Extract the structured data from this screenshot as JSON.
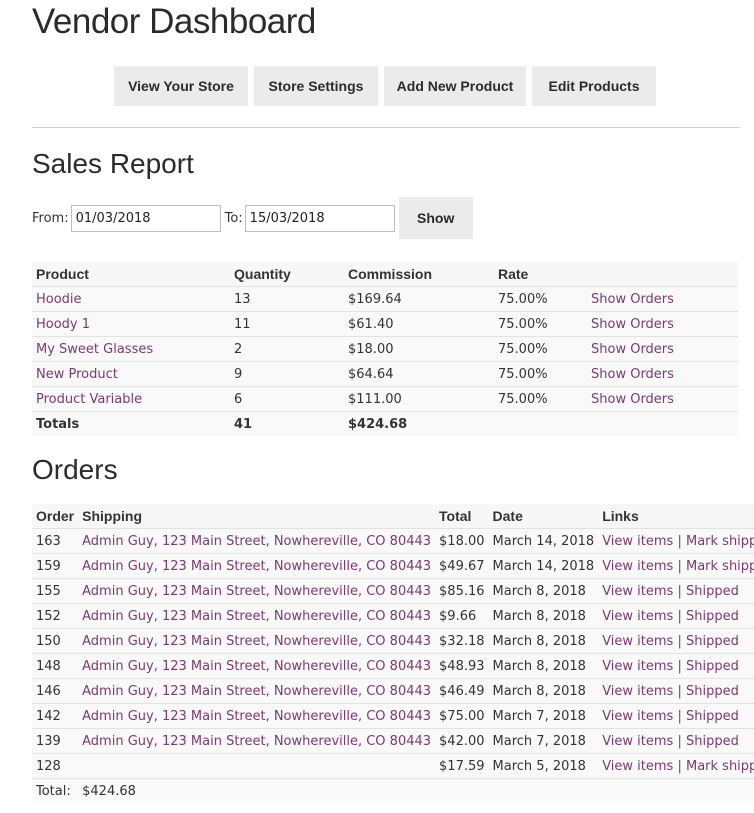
{
  "page": {
    "title": "Vendor Dashboard"
  },
  "nav": [
    {
      "label": "View Your Store"
    },
    {
      "label": "Store Settings"
    },
    {
      "label": "Add New Product"
    },
    {
      "label": "Edit Products"
    }
  ],
  "sales": {
    "title": "Sales Report",
    "from_label": "From:",
    "from_value": "01/03/2018",
    "to_label": "To:",
    "to_value": "15/03/2018",
    "show_label": "Show",
    "headers": {
      "product": "Product",
      "quantity": "Quantity",
      "commission": "Commission",
      "rate": "Rate"
    },
    "rows": [
      {
        "product": "Hoodie",
        "quantity": "13",
        "commission": "$169.64",
        "rate": "75.00%",
        "action": "Show Orders"
      },
      {
        "product": "Hoody 1",
        "quantity": "11",
        "commission": "$61.40",
        "rate": "75.00%",
        "action": "Show Orders"
      },
      {
        "product": "My Sweet Glasses",
        "quantity": "2",
        "commission": "$18.00",
        "rate": "75.00%",
        "action": "Show Orders"
      },
      {
        "product": "New Product",
        "quantity": "9",
        "commission": "$64.64",
        "rate": "75.00%",
        "action": "Show Orders"
      },
      {
        "product": "Product Variable",
        "quantity": "6",
        "commission": "$111.00",
        "rate": "75.00%",
        "action": "Show Orders"
      }
    ],
    "totals": {
      "label": "Totals",
      "quantity": "41",
      "commission": "$424.68"
    }
  },
  "orders": {
    "title": "Orders",
    "headers": {
      "order": "Order",
      "shipping": "Shipping",
      "total": "Total",
      "date": "Date",
      "links": "Links"
    },
    "view_label": "View items",
    "rows": [
      {
        "order": "163",
        "shipping": "Admin Guy, 123 Main Street, Nowhereville, CO 80443",
        "total": "$18.00",
        "date": "March 14, 2018",
        "status": "Mark shipped"
      },
      {
        "order": "159",
        "shipping": "Admin Guy, 123 Main Street, Nowhereville, CO 80443",
        "total": "$49.67",
        "date": "March 14, 2018",
        "status": "Mark shipped"
      },
      {
        "order": "155",
        "shipping": "Admin Guy, 123 Main Street, Nowhereville, CO 80443",
        "total": "$85.16",
        "date": "March 8, 2018",
        "status": "Shipped"
      },
      {
        "order": "152",
        "shipping": "Admin Guy, 123 Main Street, Nowhereville, CO 80443",
        "total": "$9.66",
        "date": "March 8, 2018",
        "status": "Shipped"
      },
      {
        "order": "150",
        "shipping": "Admin Guy, 123 Main Street, Nowhereville, CO 80443",
        "total": "$32.18",
        "date": "March 8, 2018",
        "status": "Shipped"
      },
      {
        "order": "148",
        "shipping": "Admin Guy, 123 Main Street, Nowhereville, CO 80443",
        "total": "$48.93",
        "date": "March 8, 2018",
        "status": "Shipped"
      },
      {
        "order": "146",
        "shipping": "Admin Guy, 123 Main Street, Nowhereville, CO 80443",
        "total": "$46.49",
        "date": "March 8, 2018",
        "status": "Shipped"
      },
      {
        "order": "142",
        "shipping": "Admin Guy, 123 Main Street, Nowhereville, CO 80443",
        "total": "$75.00",
        "date": "March 7, 2018",
        "status": "Shipped"
      },
      {
        "order": "139",
        "shipping": "Admin Guy, 123 Main Street, Nowhereville, CO 80443",
        "total": "$42.00",
        "date": "March 7, 2018",
        "status": "Shipped"
      },
      {
        "order": "128",
        "shipping": "",
        "total": "$17.59",
        "date": "March 5, 2018",
        "status": "Mark shipped"
      }
    ],
    "total_label": "Total:",
    "total_value": "$424.68"
  }
}
